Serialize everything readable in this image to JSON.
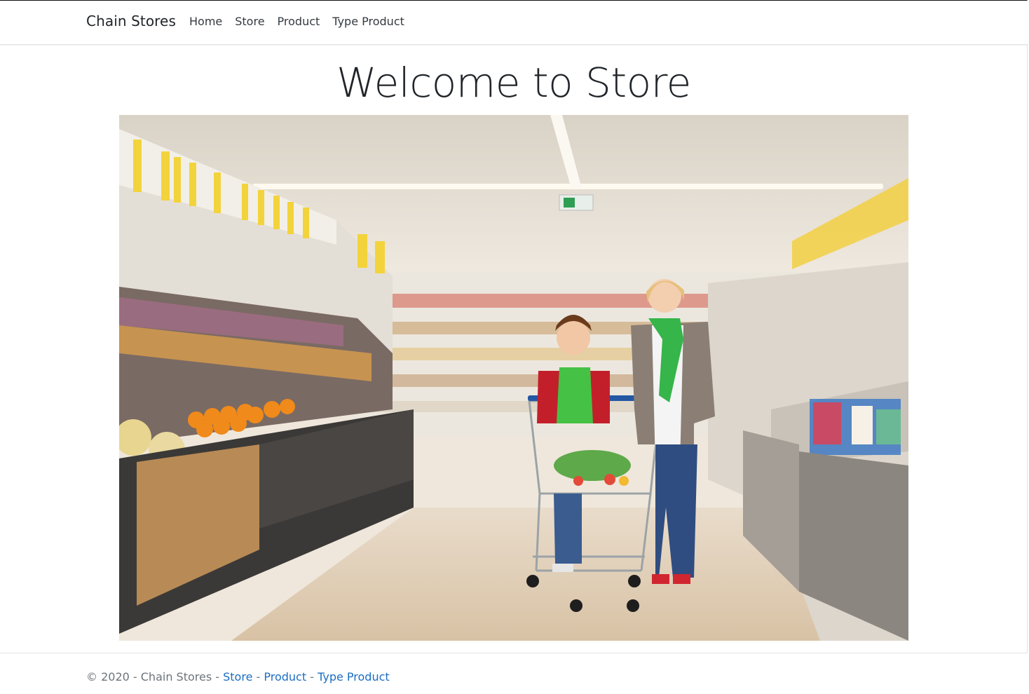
{
  "navbar": {
    "brand": "Chain Stores",
    "links": [
      "Home",
      "Store",
      "Product",
      "Type Product"
    ]
  },
  "main": {
    "heading": "Welcome to Store",
    "hero_image": {
      "alt": "Mother and son with a shopping cart in a supermarket aisle"
    }
  },
  "footer": {
    "copyright": "© 2020 - Chain Stores",
    "separator": " - ",
    "links": [
      "Store",
      "Product",
      "Type Product"
    ]
  },
  "colors": {
    "link": "#1b6ec2",
    "text": "#212529",
    "muted": "#6c757d",
    "border": "#dee2e6"
  }
}
